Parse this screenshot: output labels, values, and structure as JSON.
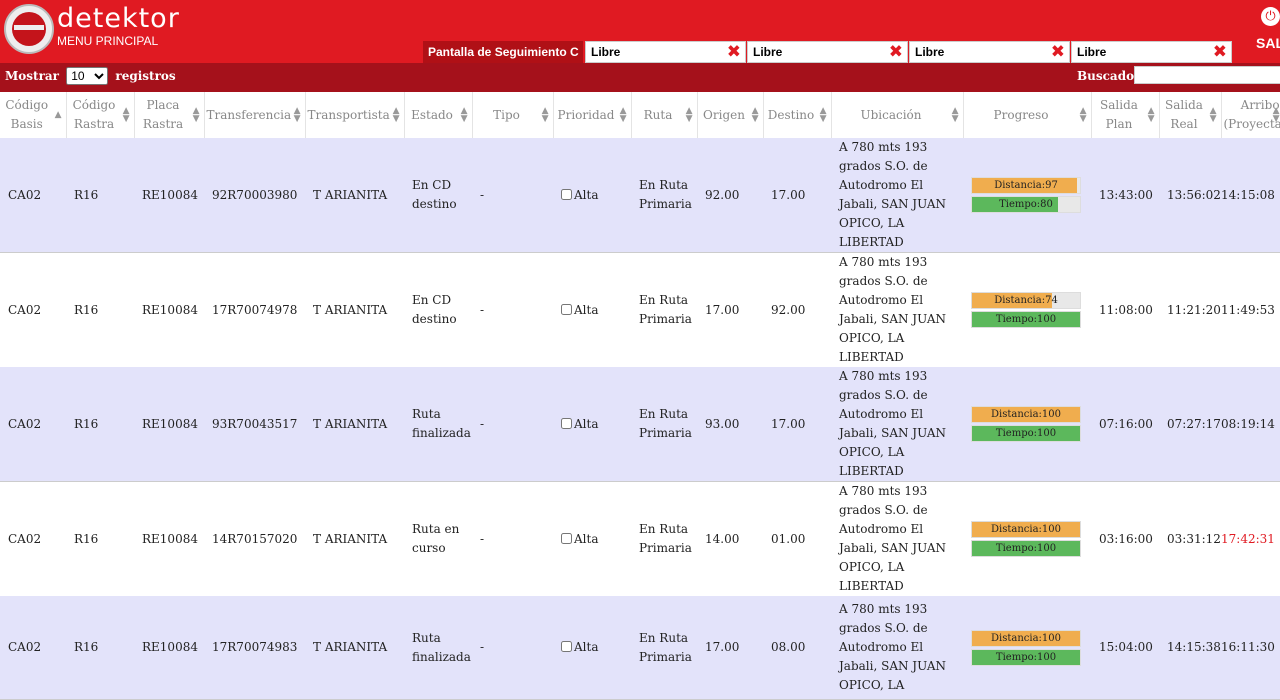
{
  "header": {
    "brand": "detektor",
    "menu_label": "MENU PRINCIPAL",
    "pantalla_label": "Pantalla de Seguimiento C",
    "filters": [
      "Libre",
      "Libre",
      "Libre",
      "Libre"
    ],
    "exit_label": "SAL"
  },
  "toolbar": {
    "show_label": "Mostrar",
    "page_size": "10",
    "records_label": "registros",
    "search_label": "Buscador:",
    "search_value": ""
  },
  "table": {
    "columns": [
      "Código Basis",
      "Código Rastra",
      "Placa Rastra",
      "Transferencia",
      "Transportista",
      "Estado",
      "Tipo",
      "Prioridad",
      "Ruta",
      "Origen",
      "Destino",
      "Ubicación",
      "Progreso",
      "Salida Plan",
      "Salida Real",
      "Arribo (Proyectado"
    ],
    "rows": [
      {
        "basis": "CA02",
        "rastra": "R16",
        "placa": "RE10084",
        "transferencia": "92R70003980",
        "transportista": "T ARIANITA",
        "estado": "En CD destino",
        "tipo": "-",
        "prioridad": "Alta",
        "ruta": "En Ruta Primaria",
        "origen": "92.00",
        "destino": "17.00",
        "ubicacion": "A 780 mts 193 grados S.O. de Autodromo El Jabali, SAN JUAN OPICO, LA LIBERTAD",
        "distancia_label": "Distancia:97",
        "distancia": 97,
        "tiempo_label": "Tiempo:80",
        "tiempo": 80,
        "salida_plan": "13:43:00",
        "salida_real": "13:56:02",
        "arribo": "14:15:08",
        "arribo_late": false
      },
      {
        "basis": "CA02",
        "rastra": "R16",
        "placa": "RE10084",
        "transferencia": "17R70074978",
        "transportista": "T ARIANITA",
        "estado": "En CD destino",
        "tipo": "-",
        "prioridad": "Alta",
        "ruta": "En Ruta Primaria",
        "origen": "17.00",
        "destino": "92.00",
        "ubicacion": "A 780 mts 193 grados S.O. de Autodromo El Jabali, SAN JUAN OPICO, LA LIBERTAD",
        "distancia_label": "Distancia:74",
        "distancia": 74,
        "tiempo_label": "Tiempo:100",
        "tiempo": 100,
        "salida_plan": "11:08:00",
        "salida_real": "11:21:20",
        "arribo": "11:49:53",
        "arribo_late": false
      },
      {
        "basis": "CA02",
        "rastra": "R16",
        "placa": "RE10084",
        "transferencia": "93R70043517",
        "transportista": "T ARIANITA",
        "estado": "Ruta finalizada",
        "tipo": "-",
        "prioridad": "Alta",
        "ruta": "En Ruta Primaria",
        "origen": "93.00",
        "destino": "17.00",
        "ubicacion": "A 780 mts 193 grados S.O. de Autodromo El Jabali, SAN JUAN OPICO, LA LIBERTAD",
        "distancia_label": "Distancia:100",
        "distancia": 100,
        "tiempo_label": "Tiempo:100",
        "tiempo": 100,
        "salida_plan": "07:16:00",
        "salida_real": "07:27:17",
        "arribo": "08:19:14",
        "arribo_late": false
      },
      {
        "basis": "CA02",
        "rastra": "R16",
        "placa": "RE10084",
        "transferencia": "14R70157020",
        "transportista": "T ARIANITA",
        "estado": "Ruta en curso",
        "tipo": "-",
        "prioridad": "Alta",
        "ruta": "En Ruta Primaria",
        "origen": "14.00",
        "destino": "01.00",
        "ubicacion": "A 780 mts 193 grados S.O. de Autodromo El Jabali, SAN JUAN OPICO, LA LIBERTAD",
        "distancia_label": "Distancia:100",
        "distancia": 100,
        "tiempo_label": "Tiempo:100",
        "tiempo": 100,
        "salida_plan": "03:16:00",
        "salida_real": "03:31:12",
        "arribo": "17:42:31",
        "arribo_late": true
      },
      {
        "basis": "CA02",
        "rastra": "R16",
        "placa": "RE10084",
        "transferencia": "17R70074983",
        "transportista": "T ARIANITA",
        "estado": "Ruta finalizada",
        "tipo": "-",
        "prioridad": "Alta",
        "ruta": "En Ruta Primaria",
        "origen": "17.00",
        "destino": "08.00",
        "ubicacion": "A 780 mts 193 grados S.O. de Autodromo El Jabali, SAN JUAN OPICO, LA",
        "distancia_label": "Distancia:100",
        "distancia": 100,
        "tiempo_label": "Tiempo:100",
        "tiempo": 100,
        "salida_plan": "15:04:00",
        "salida_real": "14:15:38",
        "arribo": "16:11:30",
        "arribo_late": false
      }
    ]
  },
  "colors": {
    "brand_red": "#e01a22",
    "sub_bar": "#a5111b",
    "row_alt": "#e3e3fa",
    "distance_bar": "#f0ad4e",
    "time_bar": "#5cb85c"
  }
}
